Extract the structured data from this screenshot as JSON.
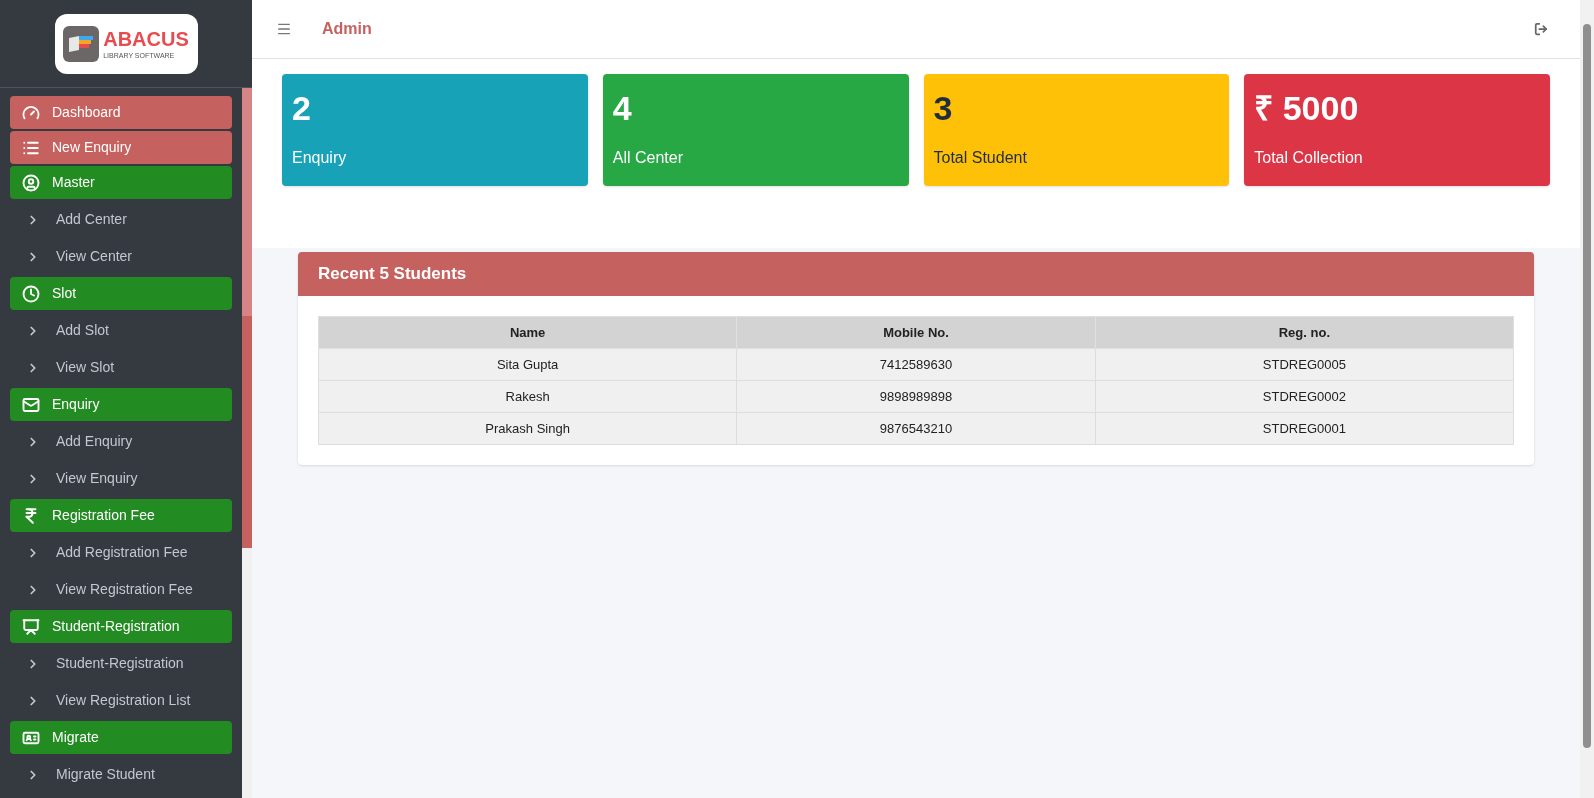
{
  "logo": {
    "title": "ABACUS",
    "subtitle": "LIBRARY SOFTWARE"
  },
  "sidebar": {
    "items": [
      {
        "kind": "header",
        "label": "Dashboard",
        "color": "#c5625f"
      },
      {
        "kind": "header",
        "label": "New Enquiry",
        "color": "#c5625f"
      },
      {
        "kind": "header",
        "label": "Master",
        "color": "#228b22"
      },
      {
        "kind": "link",
        "label": "Add Center"
      },
      {
        "kind": "link",
        "label": "View Center"
      },
      {
        "kind": "header",
        "label": "Slot",
        "color": "#228b22"
      },
      {
        "kind": "link",
        "label": "Add Slot"
      },
      {
        "kind": "link",
        "label": "View Slot"
      },
      {
        "kind": "header",
        "label": "Enquiry",
        "color": "#228b22"
      },
      {
        "kind": "link",
        "label": "Add Enquiry"
      },
      {
        "kind": "link",
        "label": "View Enquiry"
      },
      {
        "kind": "header",
        "label": "Registration Fee",
        "color": "#228b22"
      },
      {
        "kind": "link",
        "label": "Add Registration Fee"
      },
      {
        "kind": "link",
        "label": "View Registration Fee"
      },
      {
        "kind": "header",
        "label": "Student-Registration",
        "color": "#228b22"
      },
      {
        "kind": "link",
        "label": "Student-Registration"
      },
      {
        "kind": "link",
        "label": "View Registration List"
      },
      {
        "kind": "header",
        "label": "Migrate",
        "color": "#228b22"
      },
      {
        "kind": "link",
        "label": "Migrate Student"
      }
    ]
  },
  "topbar": {
    "title": "Admin"
  },
  "stats": [
    {
      "value": "2",
      "label": "Enquiry",
      "color": "#17a2b8"
    },
    {
      "value": "4",
      "label": "All Center",
      "color": "#28a745"
    },
    {
      "value": "3",
      "label": "Total Student",
      "color": "#ffc107"
    },
    {
      "value": "₹ 5000",
      "label": "Total Collection",
      "color": "#dc3545"
    }
  ],
  "recent": {
    "title": "Recent 5 Students",
    "columns": [
      "Name",
      "Mobile No.",
      "Reg. no."
    ],
    "rows": [
      [
        "Sita Gupta",
        "7412589630",
        "STDREG0005"
      ],
      [
        "Rakesh",
        "9898989898",
        "STDREG0002"
      ],
      [
        "Prakash Singh",
        "9876543210",
        "STDREG0001"
      ]
    ]
  }
}
